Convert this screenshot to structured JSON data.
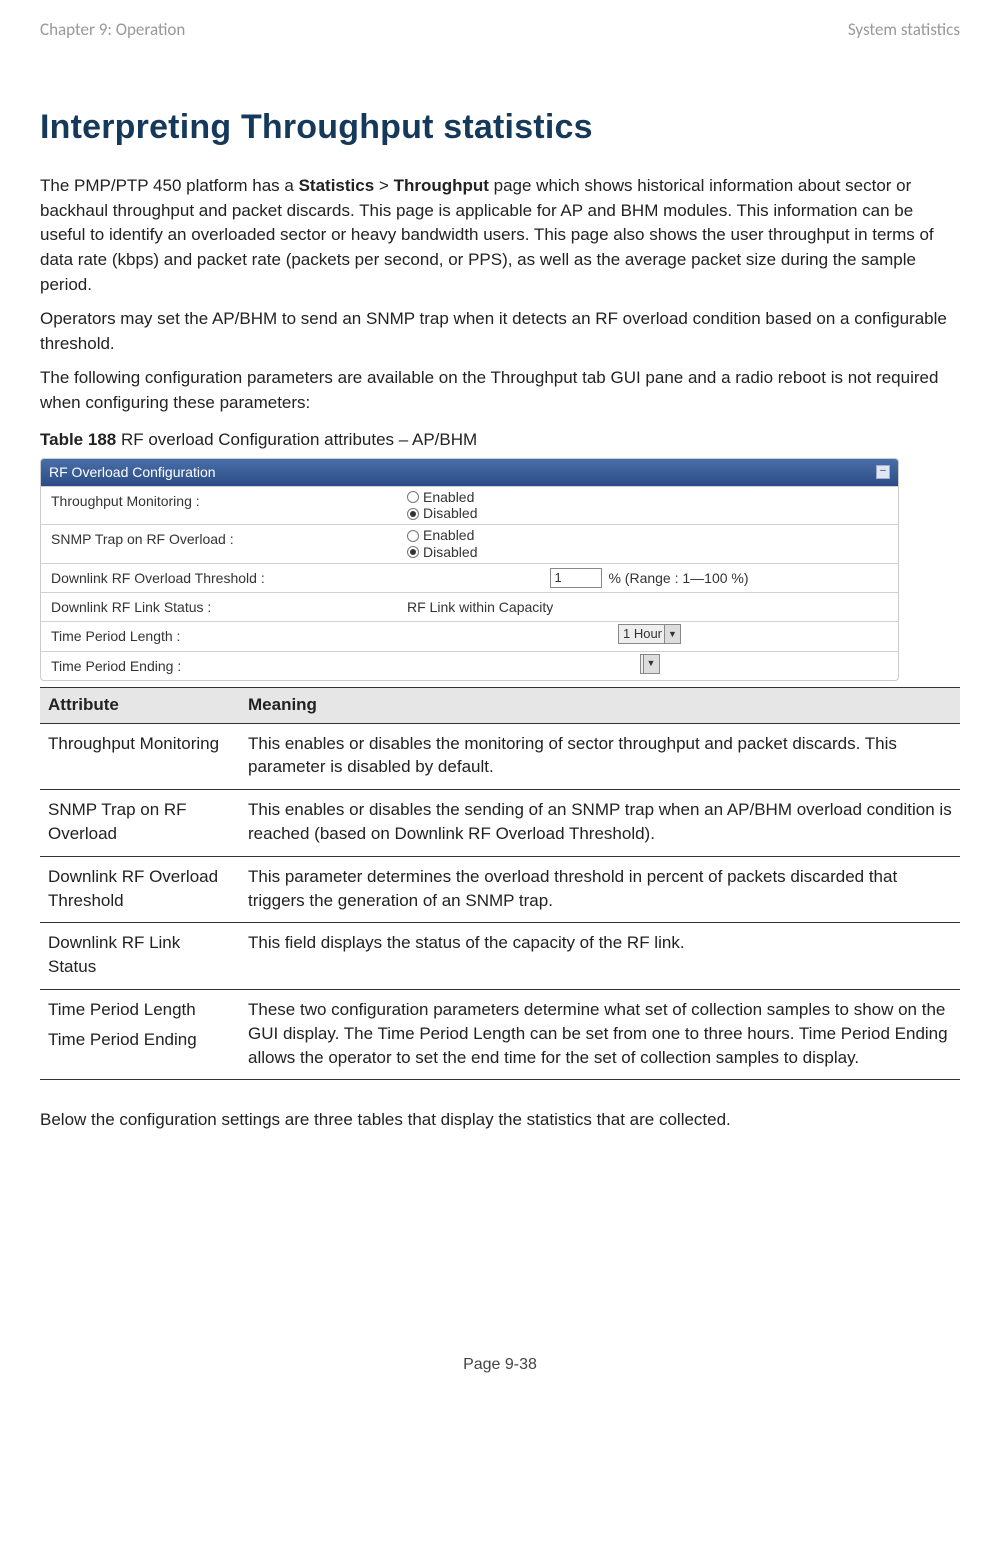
{
  "header": {
    "left": "Chapter 9:  Operation",
    "right": "System statistics"
  },
  "title": "Interpreting Throughput statistics",
  "intro": {
    "p1_pre": "The PMP/PTP 450 platform has a ",
    "p1_b1": "Statistics",
    "p1_mid1": " > ",
    "p1_b2": "Throughput",
    "p1_post": " page which shows historical information about sector or backhaul throughput and packet discards. This page is applicable for AP and BHM modules. This information can be useful to identify an overloaded sector or heavy bandwidth users. This page also shows the user throughput in terms of data rate (kbps) and packet rate (packets per second, or PPS), as well as the average packet size during the sample period.",
    "p2": "Operators may set the AP/BHM to send an SNMP trap when it detects an RF overload condition based on a configurable threshold.",
    "p3": "The following configuration parameters are available on the Throughput tab GUI pane and a radio reboot is not required when configuring these parameters:"
  },
  "table_caption": {
    "bold": "Table 188",
    "rest": " RF overload Configuration attributes – AP/BHM"
  },
  "config_panel": {
    "title": "RF Overload Configuration",
    "rows": {
      "throughput_monitoring": {
        "label": "Throughput Monitoring :",
        "opt_enabled": "Enabled",
        "opt_disabled": "Disabled",
        "selected": "disabled"
      },
      "snmp_trap": {
        "label": "SNMP Trap on RF Overload :",
        "opt_enabled": "Enabled",
        "opt_disabled": "Disabled",
        "selected": "disabled"
      },
      "dl_threshold": {
        "label": "Downlink RF Overload Threshold :",
        "value": "1",
        "suffix": "% (Range : 1—100 %)"
      },
      "dl_status": {
        "label": "Downlink RF Link Status :",
        "value": "RF Link within Capacity"
      },
      "period_length": {
        "label": "Time Period Length :",
        "value": "1 Hour"
      },
      "period_ending": {
        "label": "Time Period Ending :",
        "value": ""
      }
    }
  },
  "attr_table": {
    "col1": "Attribute",
    "col2": "Meaning",
    "rows": [
      {
        "attr": "Throughput Monitoring",
        "meaning": "This enables or disables the monitoring of sector throughput and packet discards. This parameter is disabled by default."
      },
      {
        "attr": "SNMP Trap on RF Overload",
        "meaning": "This enables or disables the sending of an SNMP trap when an AP/BHM overload condition is reached (based on Downlink RF Overload Threshold)."
      },
      {
        "attr": "Downlink RF Overload Threshold",
        "meaning": "This parameter determines the overload threshold in percent of packets discarded that triggers the generation of an SNMP trap."
      },
      {
        "attr": "Downlink RF Link Status",
        "meaning": "This field displays the status of the capacity of the RF link."
      },
      {
        "attr_multi": [
          "Time Period Length",
          "Time Period Ending"
        ],
        "meaning": "These two configuration parameters determine what set of collection samples to show on the GUI display. The Time Period Length can be set from one to three hours. Time Period Ending allows the operator to set the end time for the set of collection samples to display."
      }
    ]
  },
  "below_note": "Below the configuration settings are three tables that display the statistics that are collected.",
  "footer": "Page 9-38"
}
